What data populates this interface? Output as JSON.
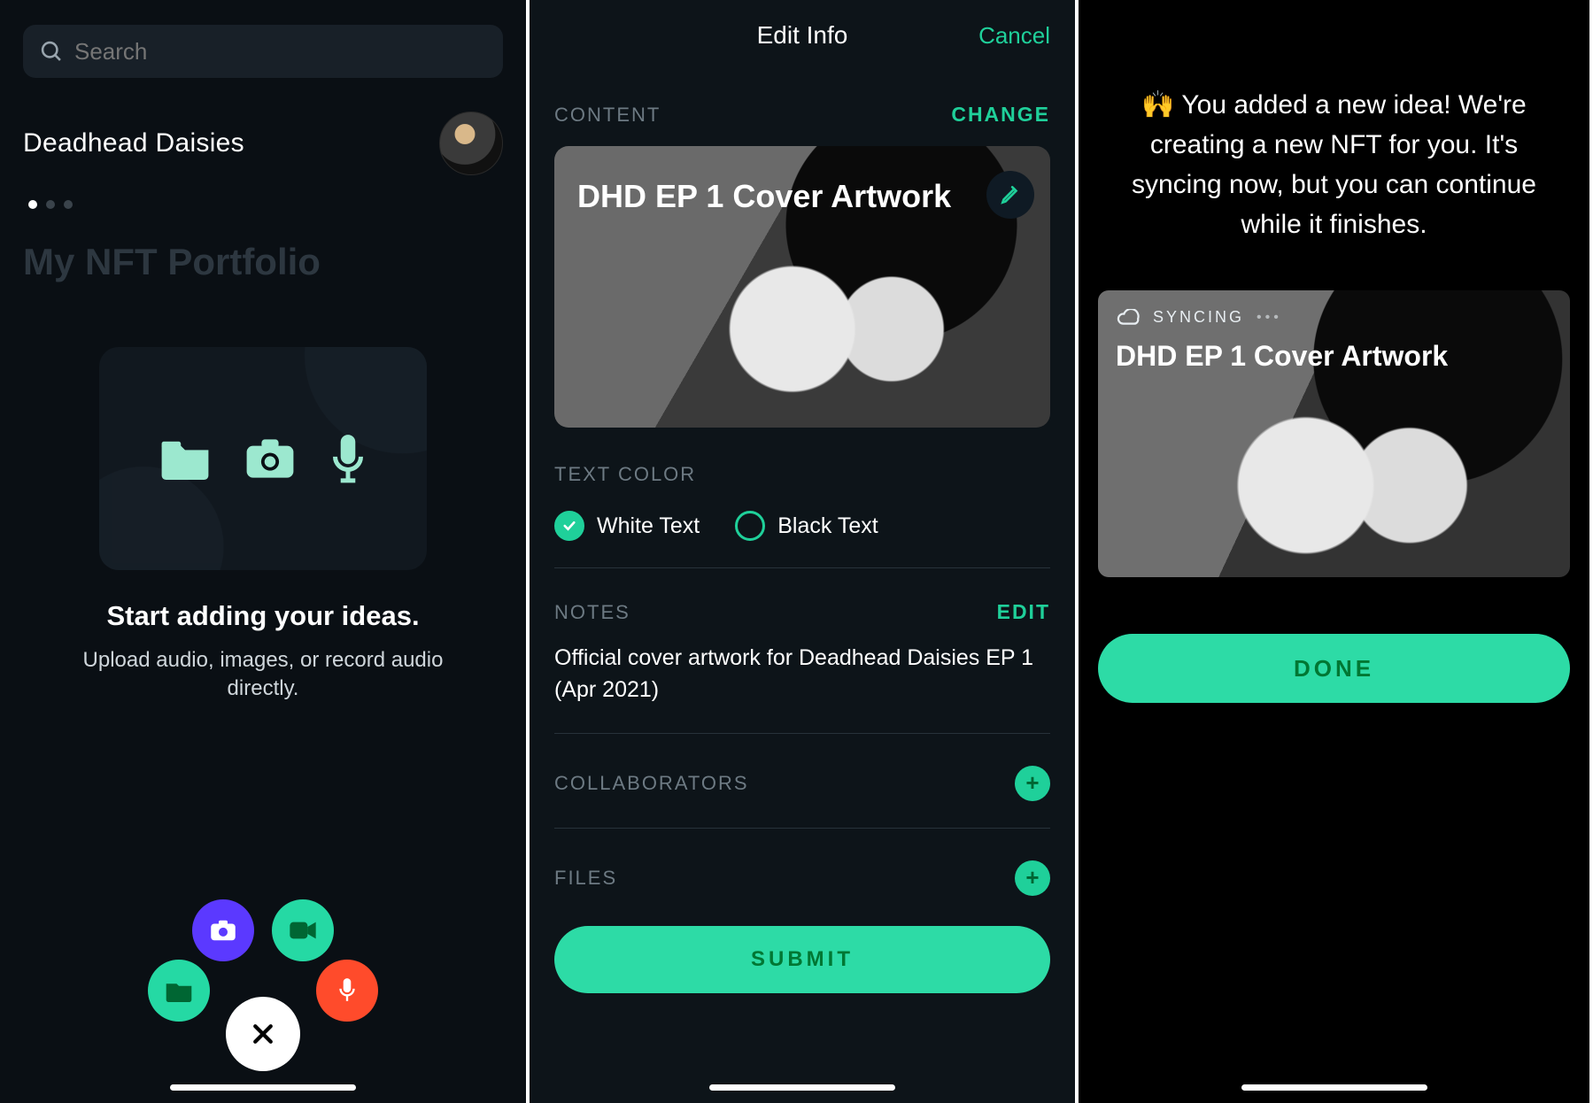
{
  "screen1": {
    "search_placeholder": "Search",
    "brand": "Deadhead Daisies",
    "portfolio_title": "My NFT Portfolio",
    "start_title": "Start adding your ideas.",
    "start_sub": "Upload audio, images, or record audio directly.",
    "page_dots": {
      "total": 3,
      "active_index": 0
    },
    "upload_icons": [
      "folder-icon",
      "camera-icon",
      "microphone-icon"
    ],
    "fab": {
      "camera": "camera-icon",
      "video": "video-icon",
      "folder": "folder-icon",
      "mic": "microphone-icon",
      "close": "close-icon"
    }
  },
  "screen2": {
    "title": "Edit Info",
    "cancel": "Cancel",
    "content_label": "CONTENT",
    "change": "CHANGE",
    "cover_title": "DHD EP 1 Cover Artwork",
    "textcolor_label": "TEXT COLOR",
    "option_white": "White Text",
    "option_black": "Black Text",
    "textcolor_selected": "white",
    "notes_label": "NOTES",
    "notes_action": "EDIT",
    "notes_text": "Official cover artwork for Deadhead Daisies EP 1 (Apr 2021)",
    "collaborators_label": "COLLABORATORS",
    "files_label": "FILES",
    "submit": "SUBMIT"
  },
  "screen3": {
    "message": "🙌 You added a new idea! We're creating a new NFT for you. It's syncing now, but you can continue while it finishes.",
    "sync_label": "SYNCING",
    "card_title": "DHD EP 1 Cover Artwork",
    "done": "DONE"
  },
  "colors": {
    "accent": "#1fd09a",
    "accent_fill": "#2ddba6",
    "fab_purple": "#5b39ff",
    "fab_red": "#ff4b2b"
  }
}
